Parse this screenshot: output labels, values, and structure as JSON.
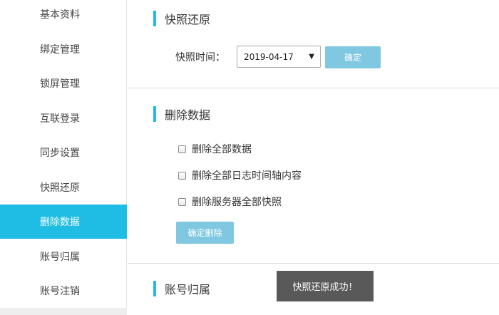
{
  "sidebar": {
    "items": [
      {
        "label": "基本资料"
      },
      {
        "label": "绑定管理"
      },
      {
        "label": "锁屏管理"
      },
      {
        "label": "互联登录"
      },
      {
        "label": "同步设置"
      },
      {
        "label": "快照还原"
      },
      {
        "label": "删除数据"
      },
      {
        "label": "账号归属"
      },
      {
        "label": "账号注销"
      }
    ],
    "active_index": 6
  },
  "snapshot": {
    "title": "快照还原",
    "time_label": "快照时间：",
    "selected_date": "2019-04-17",
    "confirm_label": "确定"
  },
  "delete_data": {
    "title": "删除数据",
    "options": [
      {
        "label": "删除全部数据",
        "checked": false
      },
      {
        "label": "删除全部日志时间轴内容",
        "checked": false
      },
      {
        "label": "删除服务器全部快照",
        "checked": false
      }
    ],
    "confirm_label": "确定删除"
  },
  "account_ownership": {
    "title": "账号归属"
  },
  "toast": {
    "message": "快照还原成功！"
  },
  "colors": {
    "accent": "#1fbde4",
    "button": "#80c8e2",
    "toast_bg": "#595959"
  }
}
